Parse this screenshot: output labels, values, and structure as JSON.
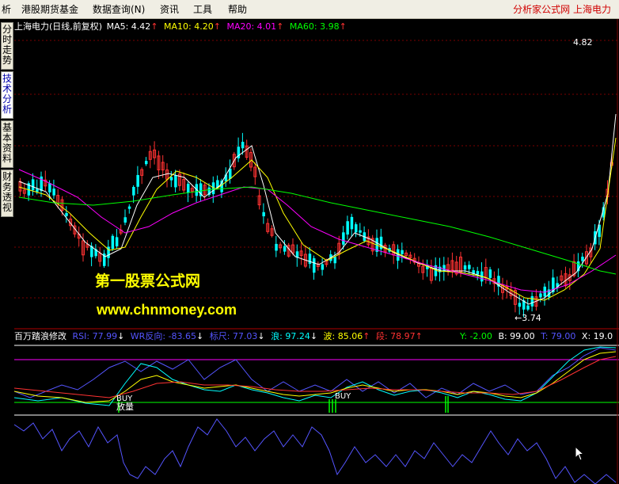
{
  "menu": {
    "items": [
      "析",
      "港股期货基金",
      "数据查询(N)",
      "资讯",
      "工具",
      "帮助"
    ],
    "brand": "分析家公式网 上海电力"
  },
  "side_tabs": [
    "分时走势",
    "技术分析",
    "基本资料",
    "财务透视"
  ],
  "main_chart": {
    "title": "上海电力(日线,前复权)",
    "ma": [
      {
        "label": "MA5: 4.42",
        "color": "#ffffff"
      },
      {
        "label": "MA10: 4.20",
        "color": "#ffff00"
      },
      {
        "label": "MA20: 4.01",
        "color": "#ff00ff"
      },
      {
        "label": "MA60: 3.98",
        "color": "#00ff00"
      }
    ],
    "high_label": "4.82",
    "low_label": "3.74",
    "up_color": "#ff3232",
    "down_color": "#00ffff"
  },
  "indicator": {
    "title": "百万踏浪修改",
    "values": [
      {
        "label": "RSI: 77.99",
        "color": "#5555ff",
        "arrow": "↓"
      },
      {
        "label": "WR反向: -83.65",
        "color": "#5555ff",
        "arrow": "↓"
      },
      {
        "label": "标尺: 77.03",
        "color": "#5555ff",
        "arrow": "↓"
      },
      {
        "label": "浪: 97.24",
        "color": "#00ffff",
        "arrow": "↓"
      },
      {
        "label": "波: 85.06",
        "color": "#ffff00",
        "arrow": "↑"
      },
      {
        "label": "段: 78.97",
        "color": "#ff3232",
        "arrow": "↑"
      }
    ],
    "cursor_values": [
      {
        "label": "Y: -2.00",
        "color": "#00ff00"
      },
      {
        "label": "B: 99.00",
        "color": "#ffffff"
      },
      {
        "label": "T: 79.00",
        "color": "#5555ff"
      },
      {
        "label": "X: 19.0",
        "color": "#ffffff"
      }
    ],
    "signals": [
      "BUY",
      "放量",
      "BUY"
    ]
  },
  "watermark": {
    "line1": "第一股票公式网",
    "line2": "www.chnmoney.com"
  }
}
